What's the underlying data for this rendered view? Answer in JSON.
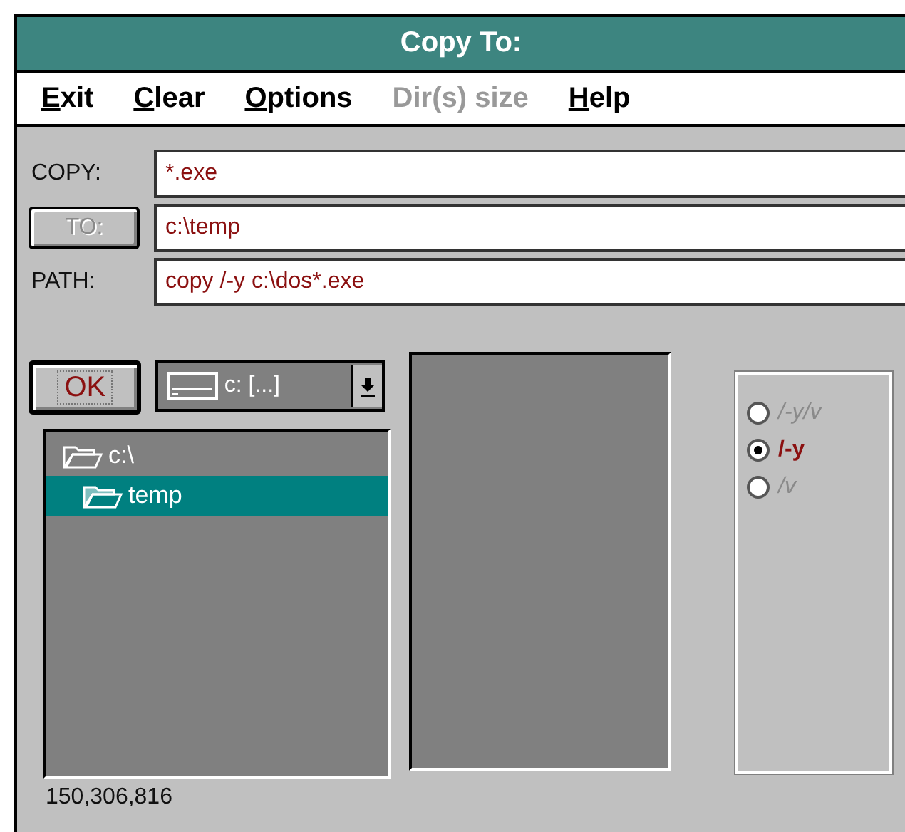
{
  "window": {
    "title": "Copy To:"
  },
  "menu": [
    {
      "label": "Exit",
      "mnemonic": true,
      "disabled": false
    },
    {
      "label": "Clear",
      "mnemonic": true,
      "disabled": false
    },
    {
      "label": "Options",
      "mnemonic": true,
      "disabled": false
    },
    {
      "label": "Dir(s) size",
      "mnemonic": false,
      "disabled": true
    },
    {
      "label": "Help",
      "mnemonic": true,
      "disabled": false
    }
  ],
  "fields": [
    {
      "kind": "label",
      "label": "COPY:",
      "value": "*.exe"
    },
    {
      "kind": "button",
      "label": "TO:",
      "disabled": true,
      "value": "c:\\temp"
    },
    {
      "kind": "label",
      "label": "PATH:",
      "value": "copy /-y c:\\dos*.exe"
    }
  ],
  "ok_button": {
    "label": "OK"
  },
  "drive": {
    "value": "c: [...]"
  },
  "tree": [
    {
      "label": "c:\\",
      "selected": false,
      "children": [
        {
          "label": "temp",
          "selected": true
        }
      ]
    }
  ],
  "options": [
    {
      "label": "/-y/v",
      "selected": false
    },
    {
      "label": "/-y",
      "selected": true
    },
    {
      "label": "/v",
      "selected": false
    }
  ],
  "status_bar": "150,306,816"
}
